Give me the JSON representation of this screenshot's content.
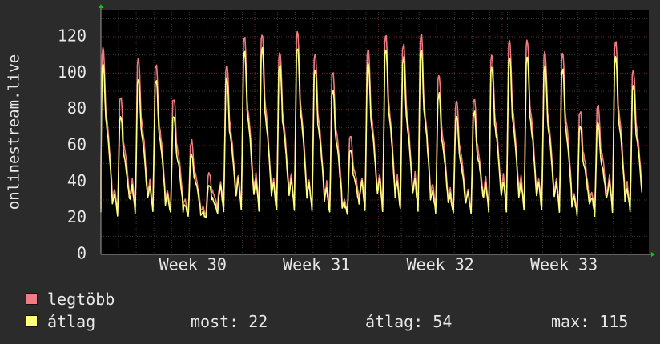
{
  "chart_data": {
    "type": "line",
    "ylabel": "onlinestream.live",
    "ylim": [
      0,
      135
    ],
    "yticks": [
      0,
      20,
      40,
      60,
      80,
      100,
      120
    ],
    "x_tick_labels": [
      "Week 30",
      "Week 31",
      "Week 32",
      "Week 33"
    ],
    "grid": true,
    "legend_position": "bottom",
    "x_days_covered": 31,
    "series": [
      {
        "name": "legtöbb",
        "color": "#f07b80",
        "daily_peaks": [
          113,
          86,
          107,
          104,
          86,
          62,
          44,
          104,
          120,
          121,
          111,
          122,
          110,
          100,
          66,
          113,
          120,
          116,
          120,
          98,
          84,
          86,
          110,
          117,
          117,
          111,
          110,
          78,
          81,
          117,
          101
        ]
      },
      {
        "name": "átlag",
        "color": "#ffff80",
        "daily_peaks": [
          105,
          76,
          96,
          96,
          76,
          55,
          38,
          96,
          111,
          113,
          104,
          114,
          102,
          90,
          58,
          105,
          112,
          108,
          112,
          88,
          76,
          78,
          102,
          108,
          108,
          103,
          101,
          70,
          72,
          108,
          93
        ]
      }
    ]
  },
  "legend": {
    "items": [
      {
        "label": "legtöbb",
        "color": "#f07b80"
      },
      {
        "label": "átlag",
        "color": "#ffff80"
      }
    ],
    "stats": {
      "current": "most: 22",
      "average": "átlag: 54",
      "max": "max: 115"
    }
  }
}
